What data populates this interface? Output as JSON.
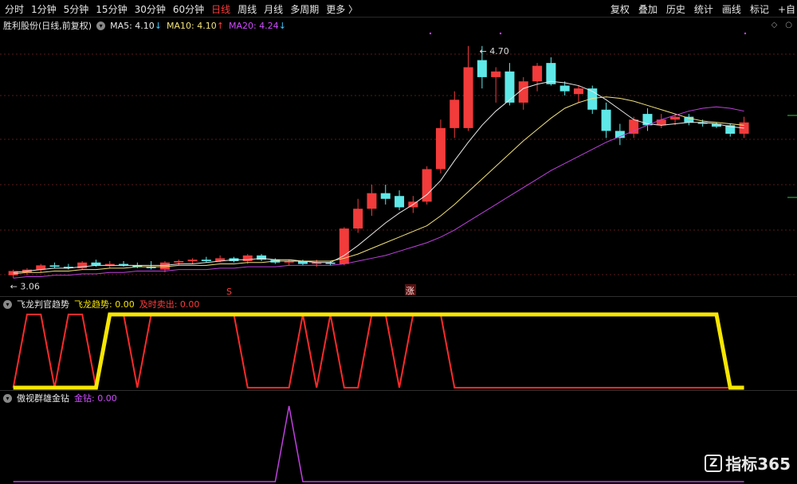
{
  "toolbar": {
    "periods": [
      "分时",
      "1分钟",
      "5分钟",
      "15分钟",
      "30分钟",
      "60分钟",
      "日线",
      "周线",
      "月线",
      "多周期",
      "更多"
    ],
    "more_label": "更多",
    "active_index": 6,
    "right_items": [
      "复权",
      "叠加",
      "历史",
      "统计",
      "画线",
      "标记",
      "+自"
    ]
  },
  "main_panel": {
    "stock_name": "胜利股份(日线,前复权)",
    "ma5_label": "MA5: 4.10",
    "ma10_label": "MA10: 4.10",
    "ma20_label": "MA20: 4.24",
    "high_label": "4.70",
    "low_label": "3.06",
    "s_marker": "S",
    "zhang_marker": "涨",
    "colors": {
      "up": "#f23b3b",
      "down": "#5fe8e8",
      "ma5": "#e8e8e8",
      "ma10": "#f2e27a",
      "ma20": "#c040e0"
    }
  },
  "chart_data": [
    {
      "type": "candlestick",
      "title": "胜利股份(日线,前复权)",
      "ylim": [
        3.0,
        4.8
      ],
      "candles": [
        {
          "o": 3.08,
          "h": 3.12,
          "l": 3.06,
          "c": 3.11
        },
        {
          "o": 3.1,
          "h": 3.13,
          "l": 3.08,
          "c": 3.12
        },
        {
          "o": 3.12,
          "h": 3.16,
          "l": 3.1,
          "c": 3.15
        },
        {
          "o": 3.15,
          "h": 3.17,
          "l": 3.13,
          "c": 3.14
        },
        {
          "o": 3.14,
          "h": 3.16,
          "l": 3.12,
          "c": 3.13
        },
        {
          "o": 3.13,
          "h": 3.18,
          "l": 3.12,
          "c": 3.17
        },
        {
          "o": 3.17,
          "h": 3.19,
          "l": 3.14,
          "c": 3.15
        },
        {
          "o": 3.15,
          "h": 3.18,
          "l": 3.13,
          "c": 3.16
        },
        {
          "o": 3.16,
          "h": 3.18,
          "l": 3.14,
          "c": 3.15
        },
        {
          "o": 3.15,
          "h": 3.17,
          "l": 3.13,
          "c": 3.14
        },
        {
          "o": 3.14,
          "h": 3.18,
          "l": 3.12,
          "c": 3.13
        },
        {
          "o": 3.12,
          "h": 3.18,
          "l": 3.1,
          "c": 3.17
        },
        {
          "o": 3.17,
          "h": 3.19,
          "l": 3.15,
          "c": 3.18
        },
        {
          "o": 3.18,
          "h": 3.2,
          "l": 3.16,
          "c": 3.19
        },
        {
          "o": 3.19,
          "h": 3.21,
          "l": 3.17,
          "c": 3.18
        },
        {
          "o": 3.18,
          "h": 3.22,
          "l": 3.17,
          "c": 3.2
        },
        {
          "o": 3.2,
          "h": 3.21,
          "l": 3.17,
          "c": 3.18
        },
        {
          "o": 3.18,
          "h": 3.23,
          "l": 3.16,
          "c": 3.22
        },
        {
          "o": 3.22,
          "h": 3.23,
          "l": 3.18,
          "c": 3.19
        },
        {
          "o": 3.19,
          "h": 3.2,
          "l": 3.16,
          "c": 3.17
        },
        {
          "o": 3.17,
          "h": 3.19,
          "l": 3.15,
          "c": 3.18
        },
        {
          "o": 3.18,
          "h": 3.19,
          "l": 3.15,
          "c": 3.16
        },
        {
          "o": 3.16,
          "h": 3.19,
          "l": 3.14,
          "c": 3.17
        },
        {
          "o": 3.17,
          "h": 3.18,
          "l": 3.15,
          "c": 3.16
        },
        {
          "o": 3.16,
          "h": 3.42,
          "l": 3.15,
          "c": 3.41
        },
        {
          "o": 3.41,
          "h": 3.62,
          "l": 3.38,
          "c": 3.55
        },
        {
          "o": 3.55,
          "h": 3.72,
          "l": 3.5,
          "c": 3.66
        },
        {
          "o": 3.66,
          "h": 3.72,
          "l": 3.58,
          "c": 3.62
        },
        {
          "o": 3.64,
          "h": 3.68,
          "l": 3.54,
          "c": 3.56
        },
        {
          "o": 3.56,
          "h": 3.64,
          "l": 3.52,
          "c": 3.6
        },
        {
          "o": 3.6,
          "h": 3.85,
          "l": 3.58,
          "c": 3.83
        },
        {
          "o": 3.83,
          "h": 4.18,
          "l": 3.8,
          "c": 4.12
        },
        {
          "o": 4.12,
          "h": 4.38,
          "l": 4.05,
          "c": 4.32
        },
        {
          "o": 4.12,
          "h": 4.7,
          "l": 4.1,
          "c": 4.55
        },
        {
          "o": 4.6,
          "h": 4.7,
          "l": 4.4,
          "c": 4.48
        },
        {
          "o": 4.48,
          "h": 4.55,
          "l": 4.3,
          "c": 4.52
        },
        {
          "o": 4.52,
          "h": 4.58,
          "l": 4.28,
          "c": 4.3
        },
        {
          "o": 4.3,
          "h": 4.48,
          "l": 4.25,
          "c": 4.45
        },
        {
          "o": 4.45,
          "h": 4.58,
          "l": 4.38,
          "c": 4.56
        },
        {
          "o": 4.58,
          "h": 4.62,
          "l": 4.42,
          "c": 4.43
        },
        {
          "o": 4.42,
          "h": 4.45,
          "l": 4.35,
          "c": 4.38
        },
        {
          "o": 4.36,
          "h": 4.42,
          "l": 4.3,
          "c": 4.4
        },
        {
          "o": 4.4,
          "h": 4.42,
          "l": 4.22,
          "c": 4.25
        },
        {
          "o": 4.25,
          "h": 4.3,
          "l": 4.05,
          "c": 4.1
        },
        {
          "o": 4.1,
          "h": 4.15,
          "l": 4.0,
          "c": 4.05
        },
        {
          "o": 4.08,
          "h": 4.2,
          "l": 4.05,
          "c": 4.18
        },
        {
          "o": 4.22,
          "h": 4.26,
          "l": 4.1,
          "c": 4.14
        },
        {
          "o": 4.14,
          "h": 4.22,
          "l": 4.12,
          "c": 4.18
        },
        {
          "o": 4.18,
          "h": 4.22,
          "l": 4.14,
          "c": 4.2
        },
        {
          "o": 4.2,
          "h": 4.22,
          "l": 4.14,
          "c": 4.16
        },
        {
          "o": 4.16,
          "h": 4.18,
          "l": 4.13,
          "c": 4.15
        },
        {
          "o": 4.15,
          "h": 4.16,
          "l": 4.12,
          "c": 4.13
        },
        {
          "o": 4.14,
          "h": 4.15,
          "l": 4.06,
          "c": 4.08
        },
        {
          "o": 4.08,
          "h": 4.2,
          "l": 4.05,
          "c": 4.16
        }
      ],
      "ma5": [
        3.1,
        3.11,
        3.12,
        3.13,
        3.13,
        3.14,
        3.15,
        3.15,
        3.15,
        3.15,
        3.15,
        3.15,
        3.16,
        3.16,
        3.17,
        3.18,
        3.19,
        3.19,
        3.2,
        3.19,
        3.19,
        3.18,
        3.17,
        3.17,
        3.22,
        3.29,
        3.37,
        3.45,
        3.52,
        3.58,
        3.65,
        3.75,
        3.89,
        4.02,
        4.14,
        4.24,
        4.32,
        4.4,
        4.43,
        4.45,
        4.44,
        4.42,
        4.38,
        4.32,
        4.25,
        4.18,
        4.15,
        4.14,
        4.15,
        4.16,
        4.16,
        4.15,
        4.13,
        4.12
      ],
      "ma10": [
        3.09,
        3.1,
        3.1,
        3.11,
        3.11,
        3.12,
        3.12,
        3.13,
        3.13,
        3.14,
        3.14,
        3.14,
        3.15,
        3.15,
        3.15,
        3.16,
        3.16,
        3.17,
        3.17,
        3.18,
        3.18,
        3.18,
        3.18,
        3.18,
        3.2,
        3.23,
        3.27,
        3.31,
        3.35,
        3.39,
        3.43,
        3.5,
        3.58,
        3.67,
        3.76,
        3.85,
        3.94,
        4.03,
        4.11,
        4.19,
        4.26,
        4.3,
        4.33,
        4.34,
        4.33,
        4.31,
        4.28,
        4.25,
        4.22,
        4.19,
        4.17,
        4.16,
        4.15,
        4.14
      ],
      "ma20": [
        3.06,
        3.07,
        3.07,
        3.08,
        3.08,
        3.09,
        3.09,
        3.1,
        3.1,
        3.11,
        3.11,
        3.11,
        3.12,
        3.12,
        3.12,
        3.13,
        3.13,
        3.14,
        3.14,
        3.14,
        3.15,
        3.15,
        3.15,
        3.15,
        3.16,
        3.18,
        3.2,
        3.22,
        3.25,
        3.28,
        3.31,
        3.35,
        3.4,
        3.46,
        3.52,
        3.58,
        3.64,
        3.7,
        3.76,
        3.82,
        3.87,
        3.92,
        3.97,
        4.02,
        4.06,
        4.1,
        4.14,
        4.18,
        4.21,
        4.24,
        4.26,
        4.27,
        4.26,
        4.24
      ]
    },
    {
      "type": "line",
      "title": "飞龙判官趋势",
      "ylim": [
        0,
        1
      ],
      "series": [
        {
          "name": "飞龙趋势",
          "values": [
            0,
            0,
            0,
            0,
            0,
            0,
            0,
            1,
            1,
            1,
            1,
            1,
            1,
            1,
            1,
            1,
            1,
            1,
            1,
            1,
            1,
            1,
            1,
            1,
            1,
            1,
            1,
            1,
            1,
            1,
            1,
            1,
            1,
            1,
            1,
            1,
            1,
            1,
            1,
            1,
            1,
            1,
            1,
            1,
            1,
            1,
            1,
            1,
            1,
            1,
            1,
            1,
            0,
            0
          ]
        },
        {
          "name": "及时卖出",
          "values": [
            0,
            1,
            1,
            0,
            1,
            1,
            0,
            1,
            1,
            0,
            1,
            1,
            1,
            1,
            1,
            1,
            1,
            0,
            0,
            0,
            0,
            1,
            0,
            1,
            0,
            0,
            1,
            1,
            0,
            1,
            1,
            1,
            0,
            0,
            0,
            0,
            0,
            0,
            0,
            0,
            0,
            0,
            0,
            0,
            0,
            0,
            0,
            0,
            0,
            0,
            0,
            0,
            0,
            0
          ]
        }
      ]
    },
    {
      "type": "line",
      "title": "傲视群雄金钻",
      "ylim": [
        0,
        1
      ],
      "series": [
        {
          "name": "金钻",
          "values": [
            0,
            0,
            0,
            0,
            0,
            0,
            0,
            0,
            0,
            0,
            0,
            0,
            0,
            0,
            0,
            0,
            0,
            0,
            0,
            0,
            1,
            0,
            0,
            0,
            0,
            0,
            0,
            0,
            0,
            0,
            0,
            0,
            0,
            0,
            0,
            0,
            0,
            0,
            0,
            0,
            0,
            0,
            0,
            0,
            0,
            0,
            0,
            0,
            0,
            0,
            0,
            0,
            0,
            0
          ]
        }
      ]
    }
  ],
  "panel2": {
    "title": "飞龙判官趋势",
    "series1_label": "飞龙趋势: 0.00",
    "series2_label": "及时卖出: 0.00",
    "colors": {
      "trend": "#f7e600",
      "sell": "#ff2a2a"
    }
  },
  "panel3": {
    "title": "傲视群雄金钻",
    "series_label": "金钻: 0.00",
    "colors": {
      "diamond": "#c040e0"
    }
  },
  "watermark": {
    "logo_letter": "Z",
    "text": "指标365"
  }
}
